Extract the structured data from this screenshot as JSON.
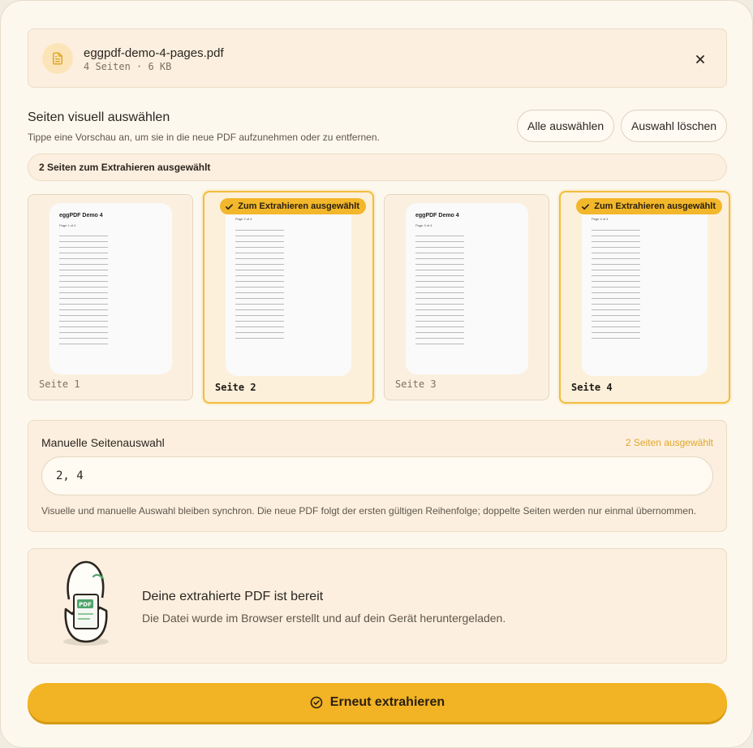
{
  "file": {
    "name": "eggpdf-demo-4-pages.pdf",
    "meta": "4 Seiten · 6 KB",
    "icon": "document-icon",
    "close_icon": "close-icon"
  },
  "visual": {
    "title": "Seiten visuell auswählen",
    "subtitle": "Tippe eine Vorschau an, um sie in die neue PDF aufzunehmen oder zu entfernen.",
    "select_all": "Alle auswählen",
    "clear": "Auswahl löschen",
    "status": "2 Seiten zum Extrahieren ausgewählt"
  },
  "pages": [
    {
      "label": "Seite 1",
      "selected": false,
      "thumb_title": "eggPDF Demo 4",
      "thumb_page": "Page 1 of 4"
    },
    {
      "label": "Seite 2",
      "selected": true,
      "badge": "Zum Extrahieren ausgewählt",
      "thumb_page": "Page 2 of 4"
    },
    {
      "label": "Seite 3",
      "selected": false,
      "thumb_title": "eggPDF Demo 4",
      "thumb_page": "Page 3 of 4"
    },
    {
      "label": "Seite 4",
      "selected": true,
      "badge": "Zum Extrahieren ausgewählt",
      "thumb_page": "Page 4 of 4"
    }
  ],
  "manual": {
    "title": "Manuelle Seitenauswahl",
    "count": "2 Seiten ausgewählt",
    "value": "2, 4",
    "hint": "Visuelle und manuelle Auswahl bleiben synchron. Die neue PDF folgt der ersten gültigen Reihenfolge; doppelte Seiten werden nur einmal übernommen."
  },
  "result": {
    "title": "Deine extrahierte PDF ist bereit",
    "subtitle": "Die Datei wurde im Browser erstellt und auf dein Gerät heruntergeladen.",
    "illustration_badge": "PDF"
  },
  "action": {
    "label": "Erneut extrahieren",
    "icon": "check-circle-icon"
  },
  "colors": {
    "accent": "#f2b324",
    "background": "#fdf8ee",
    "panel": "#fcefdf"
  }
}
